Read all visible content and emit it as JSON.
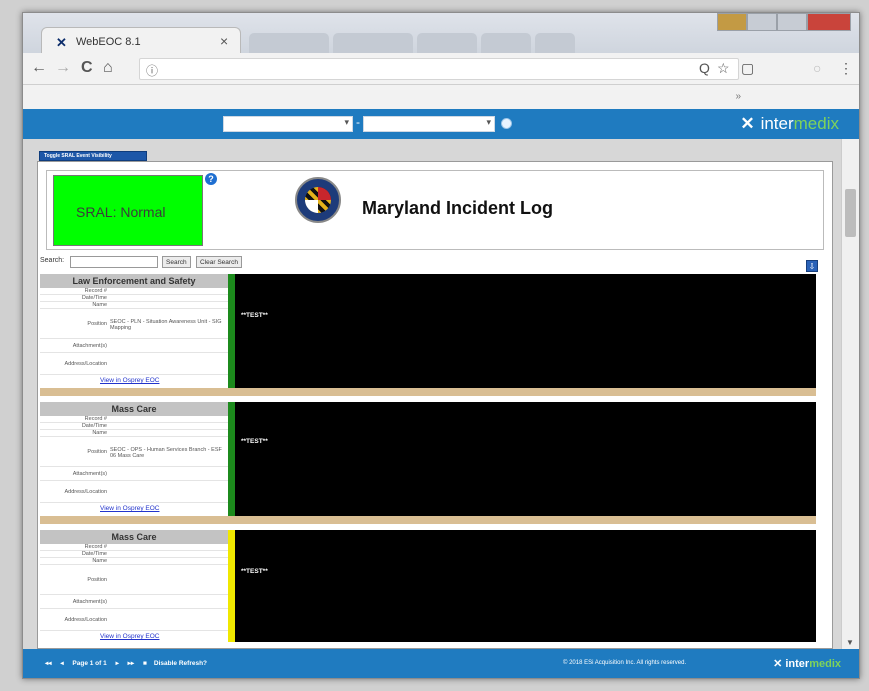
{
  "browser": {
    "tab_title": "WebEOC 8.1",
    "tab_close": "×",
    "nav_back": "←",
    "nav_forward": "→",
    "nav_reload": "C",
    "nav_home": "⌂",
    "info_icon": "ⓘ",
    "zoom_icon": "Q",
    "star_icon": "☆",
    "cast_icon": "▢",
    "menu_icon": "⋮"
  },
  "header": {
    "select_1": "",
    "select_2": "",
    "dash": "-",
    "brand_prefix": "inter",
    "brand_accent": "medix"
  },
  "board": {
    "tab_label": "Toggle SRAL Event Visibility",
    "sral_status": "SRAL: Normal",
    "help": "?",
    "title": "Maryland Incident Log",
    "search_label": "Search:",
    "search_value": "",
    "search_button": "Search",
    "clear_button": "Clear Search"
  },
  "field_labels": {
    "record": "Record #",
    "datetime": "Date/Time",
    "name": "Name",
    "position": "Position",
    "attachments": "Attachment(s)",
    "address": "Address/Location"
  },
  "records": [
    {
      "title": "Law Enforcement and Safety",
      "position": "SEOC - PLN - Situation Awareness Unit - SIG Mapping",
      "link": "View in Osprey EOC",
      "body": "**TEST**",
      "bar_color": "#1c8a1c"
    },
    {
      "title": "Mass Care",
      "position": "SEOC - OPS - Human Services Branch - ESF 06 Mass Care",
      "link": "View in Osprey EOC",
      "body": "**TEST**",
      "bar_color": "#1c8a1c"
    },
    {
      "title": "Mass Care",
      "position": "",
      "link": "View in Osprey EOC",
      "body": "**TEST**",
      "bar_color": "#f0e800"
    }
  ],
  "footer": {
    "first": "◂◂",
    "prev": "◂",
    "page": "Page 1 of 1",
    "next": "▸",
    "last": "▸▸",
    "disable_refresh": "Disable Refresh?",
    "copyright": "© 2018 ESi Acquisition Inc. All rights reserved.",
    "brand_prefix": "inter",
    "brand_accent": "medix"
  },
  "colors": {
    "accent": "#1f7bc0",
    "sral_normal": "#00ff00",
    "separator": "#d9be93"
  }
}
